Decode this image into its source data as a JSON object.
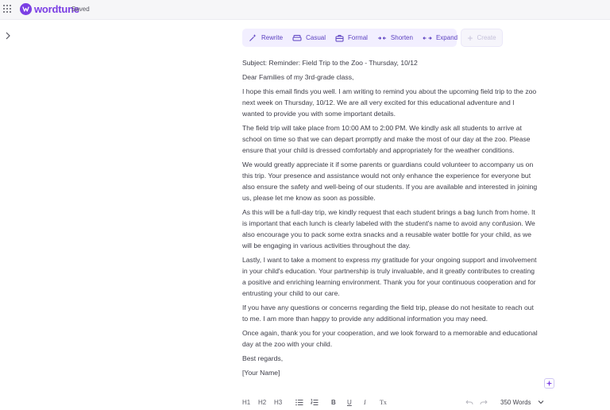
{
  "app": {
    "brand": "wordtune",
    "status": "Saved"
  },
  "toolbar": {
    "items": [
      {
        "label": "Rewrite",
        "icon": "magic-wand-icon"
      },
      {
        "label": "Casual",
        "icon": "sofa-icon"
      },
      {
        "label": "Formal",
        "icon": "briefcase-icon"
      },
      {
        "label": "Shorten",
        "icon": "arrows-inward-icon"
      },
      {
        "label": "Expand",
        "icon": "arrows-outward-icon"
      }
    ],
    "create_label": "Create"
  },
  "document": {
    "paragraphs": [
      "Subject: Reminder: Field Trip to the Zoo - Thursday, 10/12",
      "Dear Families of my 3rd-grade class,",
      "I hope this email finds you well. I am writing to remind you about the upcoming field trip to the zoo next week on Thursday, 10/12. We are all very excited for this educational adventure and I wanted to provide you with some important details.",
      "The field trip will take place from 10:00 AM to 2:00 PM. We kindly ask all students to arrive at school on time so that we can depart promptly and make the most of our day at the zoo. Please ensure that your child is dressed comfortably and appropriately for the weather conditions.",
      "We would greatly appreciate it if some parents or guardians could volunteer to accompany us on this trip. Your presence and assistance would not only enhance the experience for everyone but also ensure the safety and well-being of our students. If you are available and interested in joining us, please let me know as soon as possible.",
      "As this will be a full-day trip, we kindly request that each student brings a bag lunch from home. It is important that each lunch is clearly labeled with the student's name to avoid any confusion. We also encourage you to pack some extra snacks and a reusable water bottle for your child, as we will be engaging in various activities throughout the day.",
      "Lastly, I want to take a moment to express my gratitude for your ongoing support and involvement in your child's education. Your partnership is truly invaluable, and it greatly contributes to creating a positive and enriching learning environment. Thank you for your continuous cooperation and for entrusting your child to our care.",
      "If you have any questions or concerns regarding the field trip, please do not hesitate to reach out to me. I am more than happy to provide any additional information you may need.",
      "Once again, thank you for your cooperation, and we look forward to a memorable and educational day at the zoo with your child.",
      "Best regards,",
      "[Your Name]"
    ]
  },
  "format_bar": {
    "h1": "H1",
    "h2": "H2",
    "h3": "H3",
    "bold": "B",
    "italic": "I",
    "underline": "U",
    "clear": "Tx",
    "word_count": "350 Words"
  },
  "colors": {
    "accent": "#7b3fe4",
    "toolbar_bg": "#f2efff",
    "toolbar_text": "#5a3fc0"
  }
}
